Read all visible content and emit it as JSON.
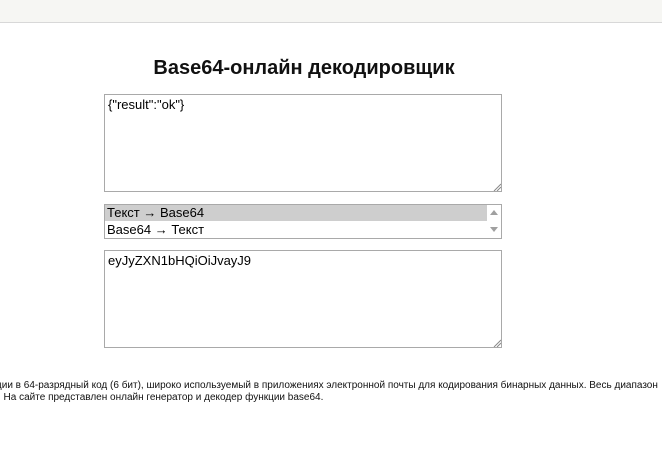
{
  "page": {
    "title": "Base64-онлайн декодировщик"
  },
  "input_area": {
    "value": "{\"result\":\"ok\"}"
  },
  "mode_select": {
    "options": [
      "Текст → Base64",
      "Base64 → Текст"
    ],
    "selected_index": 0
  },
  "output_area": {
    "value": "eyJyZXN1bHQiOiJvayJ9"
  },
  "description": {
    "line1": "ции в 64-разрядный код (6 бит), широко используемый в приложениях электронной почты для кодирования бинарных данных. Весь диапазон",
    "line2": ". На сайте представлен онлайн генератор и декодер функции base64."
  },
  "colors": {
    "selected_option_bg": "#cecece",
    "border": "#a9a9a9",
    "top_band": "#f6f6f3"
  }
}
